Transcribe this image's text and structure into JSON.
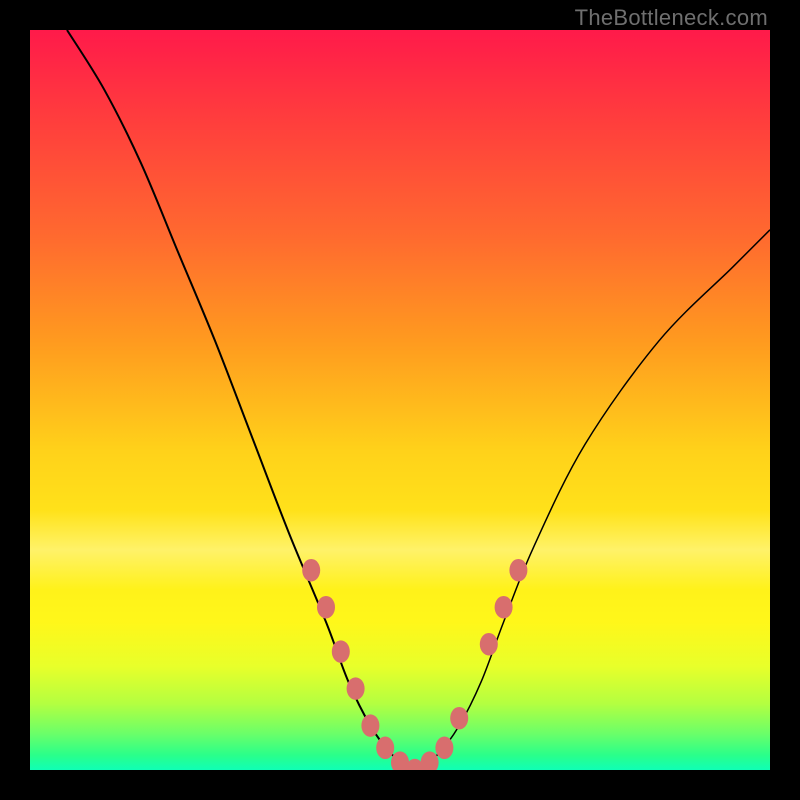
{
  "watermark": "TheBottleneck.com",
  "chart_data": {
    "type": "line",
    "title": "",
    "xlabel": "",
    "ylabel": "",
    "xlim": [
      0,
      100
    ],
    "ylim": [
      0,
      100
    ],
    "grid": false,
    "legend": false,
    "series": [
      {
        "name": "left-descending-curve",
        "x": [
          5,
          10,
          15,
          20,
          25,
          30,
          35,
          40,
          43,
          46,
          49,
          52
        ],
        "values": [
          100,
          92,
          82,
          70,
          58,
          45,
          32,
          20,
          12,
          6,
          2,
          0
        ]
      },
      {
        "name": "right-ascending-curve",
        "x": [
          52,
          55,
          58,
          61,
          64,
          68,
          75,
          85,
          95,
          100
        ],
        "values": [
          0,
          2,
          6,
          12,
          20,
          30,
          44,
          58,
          68,
          73
        ]
      }
    ],
    "markers": [
      {
        "x": 38,
        "y": 27
      },
      {
        "x": 40,
        "y": 22
      },
      {
        "x": 42,
        "y": 16
      },
      {
        "x": 44,
        "y": 11
      },
      {
        "x": 46,
        "y": 6
      },
      {
        "x": 48,
        "y": 3
      },
      {
        "x": 50,
        "y": 1
      },
      {
        "x": 52,
        "y": 0
      },
      {
        "x": 54,
        "y": 1
      },
      {
        "x": 56,
        "y": 3
      },
      {
        "x": 58,
        "y": 7
      },
      {
        "x": 62,
        "y": 17
      },
      {
        "x": 64,
        "y": 22
      },
      {
        "x": 66,
        "y": 27
      }
    ],
    "marker_color": "#d86e6e",
    "marker_radius": 9,
    "gradient_note": "vertical red-to-green heatmap background; no numeric axis ticks visible"
  }
}
